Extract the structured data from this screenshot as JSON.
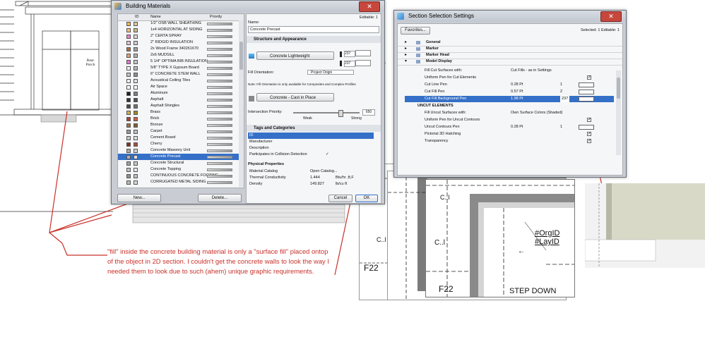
{
  "drawing": {
    "porch_label_line1": "Rear",
    "porch_label_line2": "Porch"
  },
  "building_materials": {
    "title": "Building Materials",
    "close_glyph": "✕",
    "columns": {
      "id": "ID",
      "name": "Name",
      "priority": "Priority"
    },
    "materials": [
      {
        "name": "1/2\" OSB WALL SHEATHING",
        "c1": "#f3b24c",
        "c2": "#d8c8a8"
      },
      {
        "name": "1x4 HORIZONTAL AT SIDING",
        "c1": "#f6c070",
        "c2": "#c8b890"
      },
      {
        "name": "2\" CERTA SPRAY",
        "c1": "#f080d0",
        "c2": "#d8d8d8"
      },
      {
        "name": "2\" RIDGID INSULATION",
        "c1": "#e8c0d8",
        "c2": "#d0d0d0"
      },
      {
        "name": "2x Wood Frame 340261670",
        "c1": "#b07040",
        "c2": "#a0a0a0"
      },
      {
        "name": "2x6 MUDSILL",
        "c1": "#e0a070",
        "c2": "#b0b0b0"
      },
      {
        "name": "5 1/4\" OPTIMA BIB INSULATION",
        "c1": "#e870d8",
        "c2": "#c8c8c8"
      },
      {
        "name": "5/8\" TYPE X Gypsum Board",
        "c1": "#f0f0f0",
        "c2": "#b8b8b8"
      },
      {
        "name": "6\" CONCRETE STEM WALL",
        "c1": "#c0c0c0",
        "c2": "#909090"
      },
      {
        "name": "Acoustical Ceiling Tiles",
        "c1": "#f0f0f0",
        "c2": "#e0e0e0"
      },
      {
        "name": "Air Space",
        "c1": "#ffffff",
        "c2": "#ffffff"
      },
      {
        "name": "Aluminum",
        "c1": "#202020",
        "c2": "#808080"
      },
      {
        "name": "Asphalt",
        "c1": "#303030",
        "c2": "#505050"
      },
      {
        "name": "Asphalt Shingles",
        "c1": "#484848",
        "c2": "#707070"
      },
      {
        "name": "Brass",
        "c1": "#d0b040",
        "c2": "#a08830"
      },
      {
        "name": "Brick",
        "c1": "#b04030",
        "c2": "#c86050"
      },
      {
        "name": "Bronze",
        "c1": "#a07040",
        "c2": "#806030"
      },
      {
        "name": "Carpet",
        "c1": "#9a9a9a",
        "c2": "#c0c0c0"
      },
      {
        "name": "Cement Board",
        "c1": "#c8c8c8",
        "c2": "#e0e0e0"
      },
      {
        "name": "Cherry",
        "c1": "#803020",
        "c2": "#a05040"
      },
      {
        "name": "Concrete Masonry Unit",
        "c1": "#a8a8a8",
        "c2": "#d0d0d0"
      },
      {
        "name": "Concrete Precast",
        "c1": "#b0b0b0",
        "c2": "#e0e0e0"
      },
      {
        "name": "Concrete Structural",
        "c1": "#a0a0a0",
        "c2": "#c8c8c8"
      },
      {
        "name": "Concrete Topping",
        "c1": "#c0c0c0",
        "c2": "#e8e8e8"
      },
      {
        "name": "CONTINUOUS CONCRETE FOOTING",
        "c1": "#909090",
        "c2": "#c0c0c0"
      },
      {
        "name": "CORRUGATED METAL SIDING",
        "c1": "#b8b8b8",
        "c2": "#d8d8d8"
      }
    ],
    "selected_material": "Concrete Precast",
    "new_button": "New...",
    "delete_button": "Delete...",
    "editable_label": "Editable: 1",
    "name_label": "Name:",
    "name_value": "Concrete Precast",
    "structure_header": "Structure and Appearance",
    "cut_fill": "Concrete Lightweight",
    "pen_number_1": "237",
    "pen_number_2": "237",
    "fill_orientation_label": "Fill Orientation:",
    "fill_orientation_value": "Project Origin",
    "note": "Note: Fill Orientation is only available for Composites and Complex Profiles",
    "surface": "Concrete - Cast in Place",
    "intersection_label": "Intersection Priority:",
    "intersection_value": "650",
    "weak_label": "Weak",
    "strong_label": "Strong",
    "tags_header": "Tags and Categories",
    "tag_rows": [
      {
        "label": "ID",
        "value": ""
      },
      {
        "label": "Manufacturer",
        "value": ""
      },
      {
        "label": "Description",
        "value": ""
      },
      {
        "label": "Participates in Collision Detection",
        "value": "✓"
      }
    ],
    "physical_header": "Physical Properties",
    "physical_rows": [
      {
        "label": "Material Catalog",
        "value": "Open Catalog...",
        "unit": ""
      },
      {
        "label": "Thermal Conductivity",
        "value": "1.444",
        "unit": "Btu/hr ,ft,F"
      },
      {
        "label": "Density",
        "value": "149.827",
        "unit": "lb/cu ft"
      }
    ],
    "cancel_button": "Cancel",
    "ok_button": "OK"
  },
  "section_settings": {
    "title": "Section Selection Settings",
    "close_glyph": "✕",
    "favorites_button": "Favorites...",
    "selected_info": "Selected: 1 Editable: 1",
    "groups": [
      "General",
      "Marker",
      "Marker Head",
      "Model Display"
    ],
    "rows": [
      {
        "label": "Fill Cut Surfaces with:",
        "value": "Cut Fills - as in Settings",
        "chk": false
      },
      {
        "label": "Uniform Pen for Cut Elements",
        "value": "",
        "chk": true
      },
      {
        "label": "Cut Line Pen",
        "value": "0.28 Pt",
        "num": "1",
        "chk": false
      },
      {
        "label": "Cut Fill Pen",
        "value": "0.57 Pt",
        "num": "2",
        "chk": false
      },
      {
        "label": "Cut Fill Background Pen",
        "value": "1.98 Pt",
        "num": "237",
        "chk": false
      },
      {
        "label": "UNCUT ELEMENTS",
        "value": "",
        "chk": false
      },
      {
        "label": "Fill Uncut Surfaces with:",
        "value": "Own Surface Colors (Shaded)",
        "chk": false
      },
      {
        "label": "Uniform Pen for Uncut Contours",
        "value": "",
        "chk": true
      },
      {
        "label": "Uncut Contours Pen",
        "value": "0.28 Pt",
        "num": "1",
        "chk": false
      },
      {
        "label": "Pictorial 3D Hatching",
        "value": "",
        "chk": true
      },
      {
        "label": "Transparency",
        "value": "",
        "chk": true
      }
    ]
  },
  "details": {
    "label_c1": "C..l",
    "label_c2": "C..l",
    "label_c3": "C..l",
    "label_f22a": "F22",
    "label_f22b": "F22",
    "label_orgid": "#OrgID",
    "label_layid": "#LayID",
    "label_step": "STEP DOWN",
    "arrow_glyph": "←"
  },
  "annotation": {
    "line1": "\"fill\" inside the concrete building material is only a \"surface fill\" placed ontop",
    "line2": "of the object in 2D section. I couldn't get the concrete walls to look the way I",
    "line3": "needed them to look due to such (ahem) unique graphic requirements."
  },
  "colors": {
    "annotation_red": "#c8312a",
    "selection_blue": "#3570c8",
    "window_gray": "#c9cdd3"
  }
}
